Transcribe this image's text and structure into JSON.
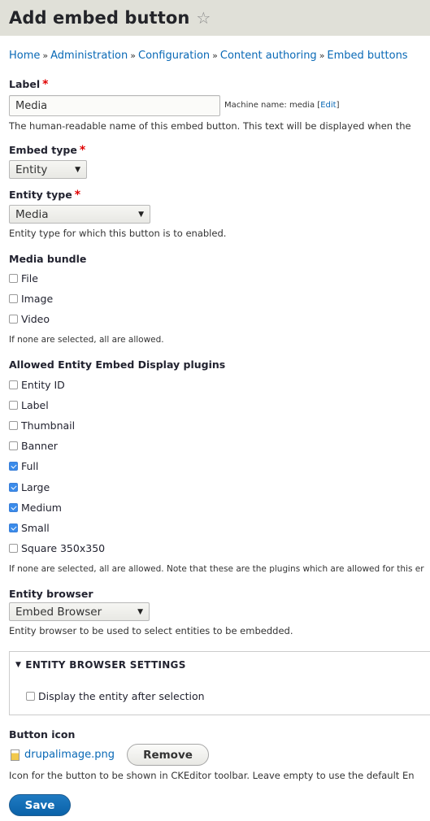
{
  "header": {
    "title": "Add embed button",
    "star_icon": "star-outline-icon"
  },
  "breadcrumb": {
    "items": [
      "Home",
      "Administration",
      "Configuration",
      "Content authoring",
      "Embed buttons"
    ],
    "separator": "»"
  },
  "label_field": {
    "label": "Label",
    "required_mark": "*",
    "value": "Media",
    "machine_name_prefix": "Machine name: media",
    "edit_link": "Edit",
    "description": "The human-readable name of this embed button. This text will be displayed when the"
  },
  "embed_type": {
    "label": "Embed type",
    "required_mark": "*",
    "selected": "Entity"
  },
  "entity_type": {
    "label": "Entity type",
    "required_mark": "*",
    "selected": "Media",
    "description": "Entity type for which this button is to enabled."
  },
  "media_bundle": {
    "label": "Media bundle",
    "options": [
      {
        "label": "File",
        "checked": false
      },
      {
        "label": "Image",
        "checked": false
      },
      {
        "label": "Video",
        "checked": false
      }
    ],
    "description": "If none are selected, all are allowed."
  },
  "display_plugins": {
    "label": "Allowed Entity Embed Display plugins",
    "options": [
      {
        "label": "Entity ID",
        "checked": false
      },
      {
        "label": "Label",
        "checked": false
      },
      {
        "label": "Thumbnail",
        "checked": false
      },
      {
        "label": "Banner",
        "checked": false
      },
      {
        "label": "Full",
        "checked": true
      },
      {
        "label": "Large",
        "checked": true
      },
      {
        "label": "Medium",
        "checked": true
      },
      {
        "label": "Small",
        "checked": true
      },
      {
        "label": "Square 350x350",
        "checked": false
      }
    ],
    "description": "If none are selected, all are allowed. Note that these are the plugins which are allowed for this er"
  },
  "entity_browser": {
    "label": "Entity browser",
    "selected": "Embed Browser",
    "description": "Entity browser to be used to select entities to be embedded."
  },
  "entity_browser_settings": {
    "summary": "ENTITY BROWSER SETTINGS",
    "option": {
      "label": "Display the entity after selection",
      "checked": false
    }
  },
  "button_icon": {
    "label": "Button icon",
    "file_name": "drupalimage.png",
    "remove_label": "Remove",
    "description": "Icon for the button to be shown in CKEditor toolbar. Leave empty to use the default En"
  },
  "actions": {
    "save_label": "Save"
  },
  "colors": {
    "link": "#0969b6",
    "primary_button": "#0a62a8",
    "required": "#e00000",
    "header_bg": "#e0e0d8",
    "checkbox_checked": "#3a8bea"
  }
}
